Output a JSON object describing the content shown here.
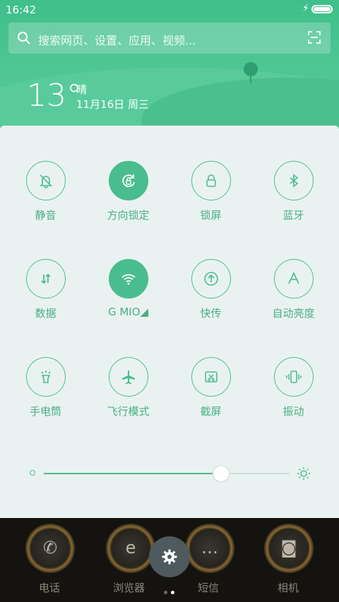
{
  "status_bar": {
    "time": "16:42",
    "charging_icon": "bolt-icon",
    "battery": "full"
  },
  "search": {
    "placeholder": "搜索网页、设置、应用、视频..."
  },
  "weather": {
    "temperature": "13°",
    "condition": "晴",
    "date": "11月16日 周三"
  },
  "toggles": [
    {
      "label": "静音",
      "icon": "bell-off-icon",
      "on": false
    },
    {
      "label": "方向锁定",
      "icon": "rotation-lock-icon",
      "on": true
    },
    {
      "label": "锁屏",
      "icon": "lock-icon",
      "on": false
    },
    {
      "label": "蓝牙",
      "icon": "bluetooth-icon",
      "on": false
    },
    {
      "label": "数据",
      "icon": "data-arrows-icon",
      "on": false
    },
    {
      "label": "G MIO◢",
      "icon": "wifi-icon",
      "on": true
    },
    {
      "label": "快传",
      "icon": "upload-icon",
      "on": false
    },
    {
      "label": "自动亮度",
      "icon": "auto-brightness-icon",
      "on": false
    },
    {
      "label": "手电筒",
      "icon": "flashlight-icon",
      "on": false
    },
    {
      "label": "飞行模式",
      "icon": "airplane-icon",
      "on": false
    },
    {
      "label": "截屏",
      "icon": "screenshot-icon",
      "on": false
    },
    {
      "label": "振动",
      "icon": "vibrate-icon",
      "on": false
    }
  ],
  "brightness": {
    "level": 0.72
  },
  "dock": [
    {
      "label": "电话",
      "icon": "phone-icon"
    },
    {
      "label": "浏览器",
      "icon": "browser-icon"
    },
    {
      "label": "短信",
      "icon": "message-icon"
    },
    {
      "label": "相机",
      "icon": "camera-icon"
    }
  ],
  "colors": {
    "accent": "#49bd8f",
    "header": "#52c796",
    "panel": "#eaf2f1"
  }
}
